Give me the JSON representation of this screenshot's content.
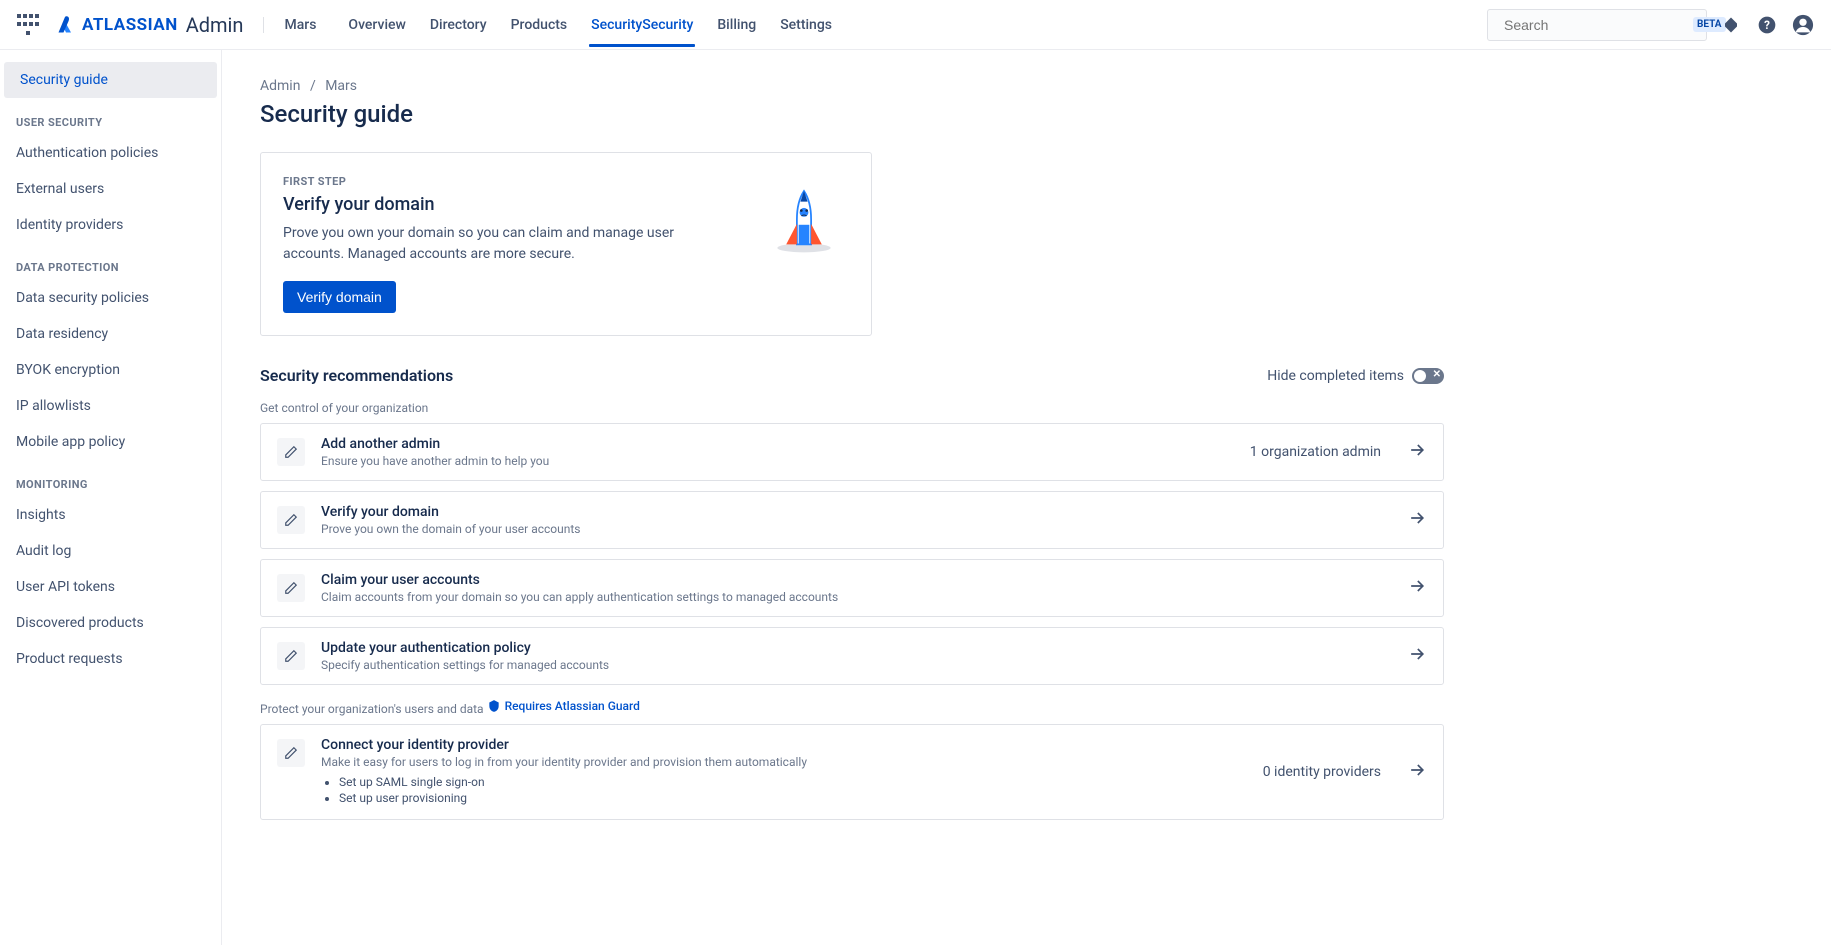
{
  "header": {
    "brand": "ATLASSIAN",
    "brand_suffix": "Admin",
    "org": "Mars",
    "nav": [
      "Overview",
      "Directory",
      "Products",
      "Security",
      "Billing",
      "Settings"
    ],
    "nav_active": "Security",
    "search_placeholder": "Search",
    "search_badge": "BETA"
  },
  "sidebar": {
    "top": "Security guide",
    "groups": [
      {
        "heading": "USER SECURITY",
        "items": [
          "Authentication policies",
          "External users",
          "Identity providers"
        ]
      },
      {
        "heading": "DATA PROTECTION",
        "items": [
          "Data security policies",
          "Data residency",
          "BYOK encryption",
          "IP allowlists",
          "Mobile app policy"
        ]
      },
      {
        "heading": "MONITORING",
        "items": [
          "Insights",
          "Audit log",
          "User API tokens",
          "Discovered products",
          "Product requests"
        ]
      }
    ]
  },
  "breadcrumb": {
    "a": "Admin",
    "b": "Mars"
  },
  "page": {
    "title": "Security guide",
    "first_step_label": "FIRST STEP",
    "first_step_title": "Verify your domain",
    "first_step_desc": "Prove you own your domain so you can claim and manage user accounts. Managed accounts are more secure.",
    "first_step_button": "Verify domain"
  },
  "recs": {
    "title": "Security recommendations",
    "hide_label": "Hide completed items",
    "group1_label": "Get control of your organization",
    "group1": [
      {
        "title": "Add another admin",
        "desc": "Ensure you have another admin to help you",
        "meta": "1 organization admin"
      },
      {
        "title": "Verify your domain",
        "desc": "Prove you own the domain of your user accounts"
      },
      {
        "title": "Claim your user accounts",
        "desc": "Claim accounts from your domain so you can apply authentication settings to managed accounts"
      },
      {
        "title": "Update your authentication policy",
        "desc": "Specify authentication settings for managed accounts"
      }
    ],
    "group2_label": "Protect your organization's users and data",
    "guard_label": "Requires Atlassian Guard",
    "group2": [
      {
        "title": "Connect your identity provider",
        "desc": "Make it easy for users to log in from your identity provider and provision them automatically",
        "meta": "0 identity providers",
        "bullets": [
          "Set up SAML single sign-on",
          "Set up user provisioning"
        ]
      }
    ]
  }
}
